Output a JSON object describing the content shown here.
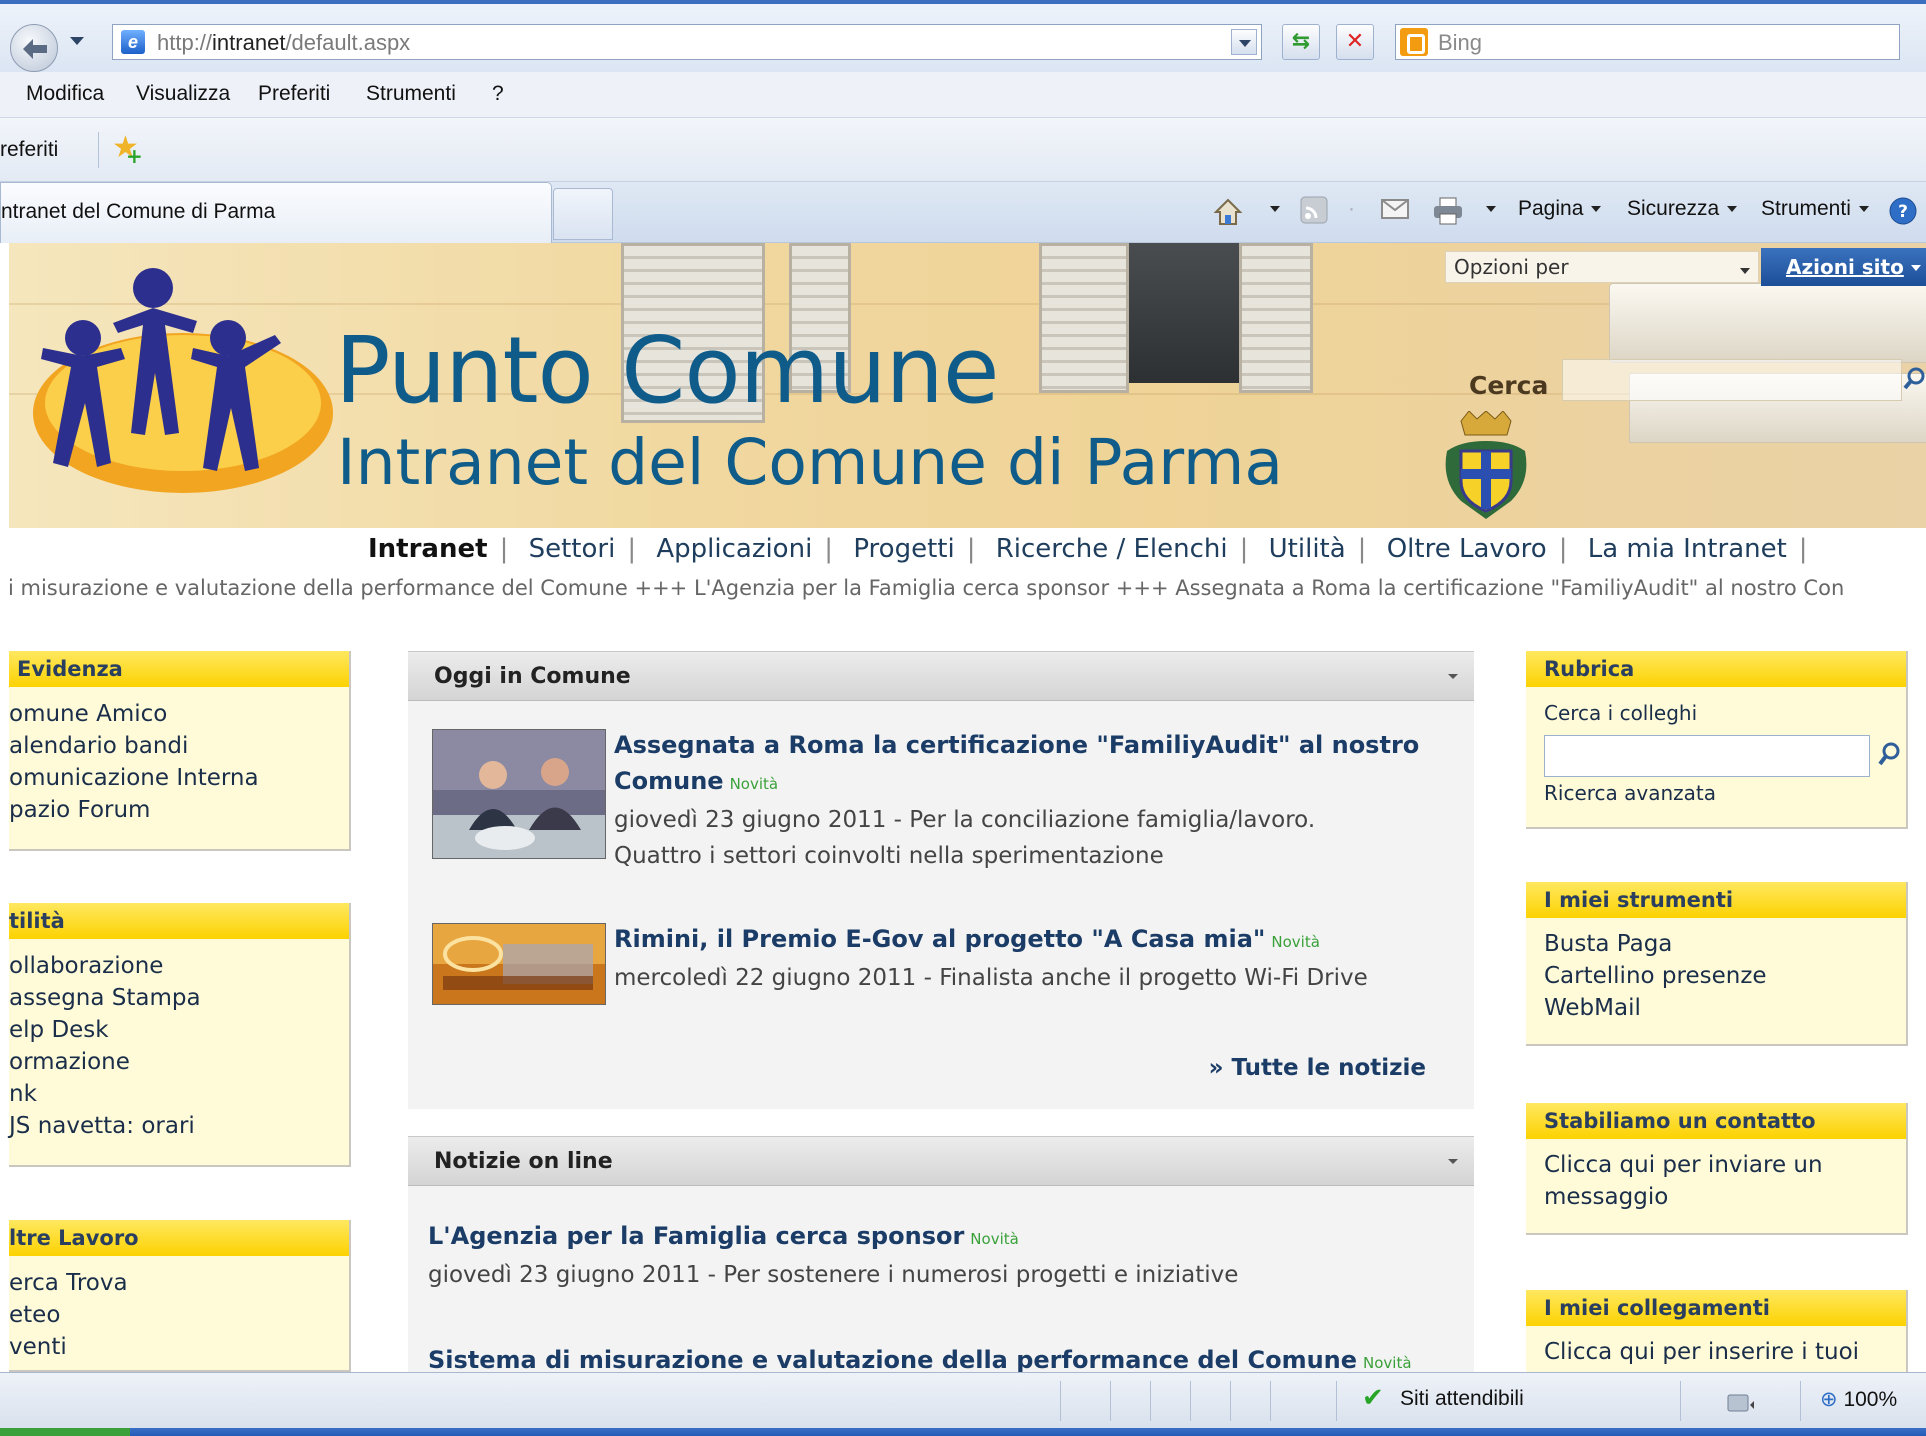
{
  "browser": {
    "url_prefix": "http://",
    "url_host": "intranet",
    "url_path": "/default.aspx",
    "search_engine": "Bing",
    "menu": [
      "Modifica",
      "Visualizza",
      "Preferiti",
      "Strumenti",
      "?"
    ],
    "favorites_label": "referiti",
    "tab_title": "ntranet del Comune di Parma",
    "commands": {
      "pagina": "Pagina",
      "sicurezza": "Sicurezza",
      "strumenti": "Strumenti"
    },
    "status_zone": "Siti attendibili",
    "zoom": "100%",
    "colors": {
      "chrome": "#dbe5f3",
      "accent": "#3c6fc0"
    }
  },
  "header": {
    "title": "Punto Comune",
    "subtitle": "Intranet del Comune di Parma",
    "options_label": "Opzioni per",
    "site_actions": "Azioni sito",
    "search_label": "Cerca",
    "colors": {
      "title": "#0f5c8a",
      "actions": "#1d4e98"
    }
  },
  "topnav": [
    "Intranet",
    "Settori",
    "Applicazioni",
    "Progetti",
    "Ricerche / Elenchi",
    "Utilità",
    "Oltre Lavoro",
    "La mia Intranet"
  ],
  "ticker": "i misurazione e valutazione della performance del Comune +++ L'Agenzia per la Famiglia cerca sponsor +++ Assegnata a Roma la certificazione \"FamiliyAudit\" al nostro Con",
  "left": {
    "evidenza": {
      "title": "Evidenza",
      "items": [
        "omune Amico",
        "alendario bandi",
        "omunicazione Interna",
        "pazio Forum"
      ]
    },
    "utilita": {
      "title": "tilità",
      "items": [
        "ollaborazione",
        "assegna Stampa",
        "elp Desk",
        "ormazione",
        "nk",
        "JS navetta: orari"
      ]
    },
    "oltre": {
      "title": "ltre Lavoro",
      "items": [
        "erca Trova",
        "eteo",
        "venti"
      ]
    },
    "colors": {
      "header": "#fcd200",
      "body": "#fffbd9"
    }
  },
  "center": {
    "oggi": {
      "title": "Oggi in Comune",
      "news": [
        {
          "title_1": "Assegnata a Roma la certificazione \"FamiliyAudit\" al nostro",
          "title_2": "Comune",
          "badge": "Novità",
          "desc_1": "giovedì 23 giugno 2011 - Per la conciliazione famiglia/lavoro.",
          "desc_2": "Quattro i settori coinvolti nella sperimentazione"
        },
        {
          "title": "Rimini, il Premio E-Gov al progetto \"A Casa mia\"",
          "badge": "Novità",
          "desc": "mercoledì 22 giugno 2011 - Finalista anche il progetto Wi-Fi Drive"
        }
      ],
      "all_news": "» Tutte le notizie"
    },
    "online": {
      "title": "Notizie on line",
      "news": [
        {
          "title": "L'Agenzia per la Famiglia cerca sponsor",
          "badge": "Novità",
          "desc": "giovedì 23 giugno 2011 - Per sostenere i numerosi progetti e iniziative"
        },
        {
          "title": "Sistema di misurazione e valutazione della performance del Comune",
          "badge": "Novità"
        }
      ]
    }
  },
  "right": {
    "rubrica": {
      "title": "Rubrica",
      "search_label": "Cerca i colleghi",
      "advanced": "Ricerca avanzata"
    },
    "strumenti": {
      "title": "I miei strumenti",
      "items": [
        "Busta Paga",
        "Cartellino presenze",
        "WebMail"
      ]
    },
    "contatto": {
      "title": "Stabiliamo un contatto",
      "line1": "Clicca qui per inviare un",
      "line2": "messaggio"
    },
    "collegamenti": {
      "title": "I miei collegamenti",
      "line1": "Clicca qui per inserire i tuoi"
    }
  }
}
